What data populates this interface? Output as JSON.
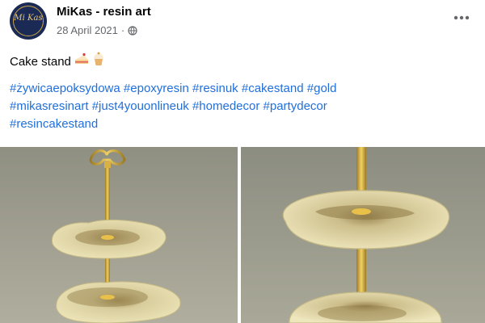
{
  "post": {
    "page_name": "MiKas - resin art",
    "avatar_text": "Mi Kas",
    "date": "28 April 2021",
    "separator": "·",
    "visibility_icon": "globe-icon",
    "more_icon": "more-horizontal-icon",
    "title": "Cake stand",
    "title_emojis": [
      "cake-slice-icon",
      "cupcake-icon"
    ],
    "hashtags": [
      "#żywicaepoksydowa",
      "#epoxyresin",
      "#resinuk",
      "#cakestand",
      "#gold",
      "#mikasresinart",
      "#just4youonlineuk",
      "#homedecor",
      "#partydecor",
      "#resincakestand"
    ]
  },
  "photos": [
    {
      "name": "cake-stand-photo-full",
      "icon": "photo"
    },
    {
      "name": "cake-stand-photo-closeup",
      "icon": "photo"
    }
  ],
  "colors": {
    "link": "#216fdb",
    "meta": "#65676b",
    "resin_cream": "#e6dfb4",
    "gold": "#d8b043",
    "background": "#9b9b8c"
  }
}
